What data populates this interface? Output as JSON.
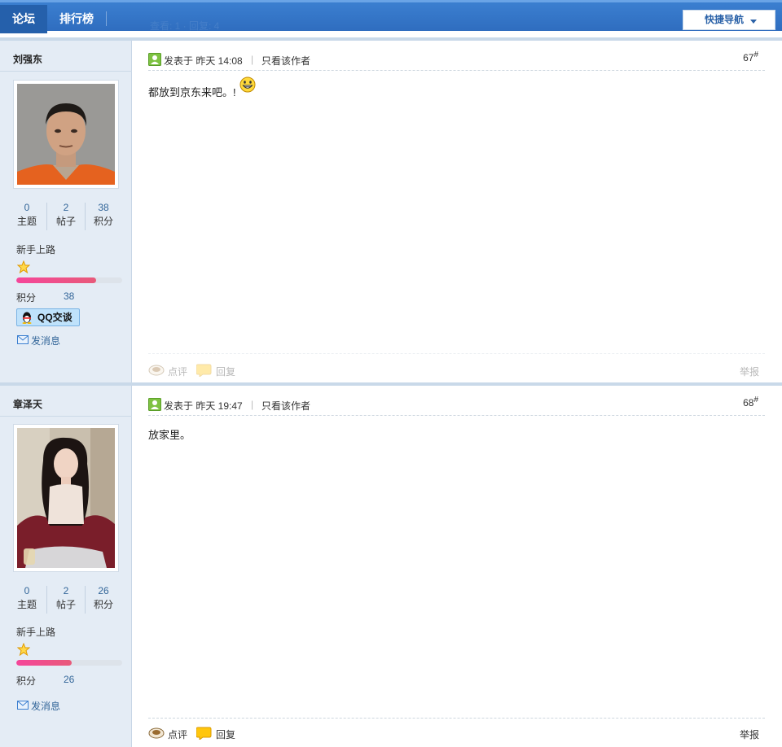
{
  "nav": {
    "tabs": [
      {
        "label": "论坛",
        "active": true
      },
      {
        "label": "排行榜",
        "active": false
      }
    ],
    "ghost_text": "查看: 1 · 回复: 4",
    "quick_nav_label": "快捷导航"
  },
  "stat_labels": {
    "threads": "主题",
    "posts": "帖子",
    "credits": "积分"
  },
  "actions": {
    "comment": "点评",
    "reply": "回复",
    "report": "举报"
  },
  "posts": [
    {
      "username": "刘强东",
      "stats": {
        "threads": "0",
        "posts": "2",
        "credits": "38"
      },
      "rank_title": "新手上路",
      "level_progress": 0.75,
      "credit_label": "积分",
      "credit_value": "38",
      "qq_label": "QQ交谈",
      "message_label": "发消息",
      "posted_at": "发表于 昨天 14:08",
      "author_only": "只看该作者",
      "floor": "67",
      "content": "都放到京东来吧。!"
    },
    {
      "username": "章泽天",
      "stats": {
        "threads": "0",
        "posts": "2",
        "credits": "26"
      },
      "rank_title": "新手上路",
      "level_progress": 0.52,
      "credit_label": "积分",
      "credit_value": "26",
      "message_label": "发消息",
      "posted_at": "发表于 昨天 19:47",
      "author_only": "只看该作者",
      "floor": "68",
      "content": "放家里。"
    }
  ],
  "colors": {
    "nav_bg": "#2f6dbf",
    "sidebar_bg": "#e4ecf5",
    "link": "#336699",
    "level_bar": "#f5469a"
  }
}
